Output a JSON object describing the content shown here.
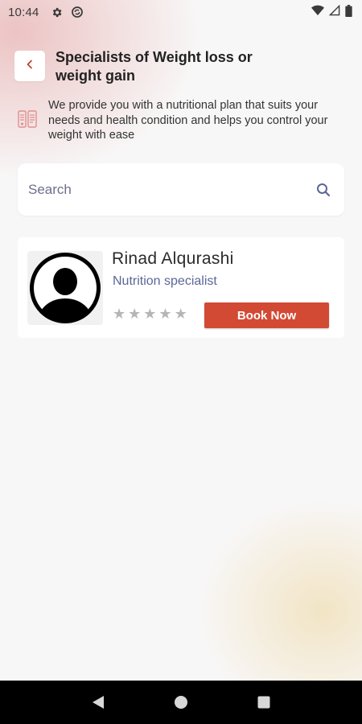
{
  "status_bar": {
    "time": "10:44",
    "icons": [
      "gear-icon",
      "sync-icon"
    ],
    "right_icons": [
      "wifi-icon",
      "signal-icon",
      "battery-icon"
    ]
  },
  "header": {
    "title": "Specialists of Weight loss or weight gain",
    "back_icon": "chevron-left-icon"
  },
  "info": {
    "icon": "nutrition-plan-icon",
    "text": "We provide you with a nutritional plan that suits your needs and health condition and helps you control your weight with ease"
  },
  "search": {
    "placeholder": "Search",
    "value": "",
    "icon": "search-icon"
  },
  "specialists": [
    {
      "name": "Rinad Alqurashi",
      "role": "Nutrition specialist",
      "rating": 0,
      "max_rating": 5,
      "book_label": "Book Now",
      "avatar": "user-avatar-placeholder"
    }
  ],
  "nav_bar": {
    "buttons": [
      "back-triangle-icon",
      "home-circle-icon",
      "recents-square-icon"
    ]
  },
  "colors": {
    "accent": "#d24a34",
    "back_chevron": "#c0392b",
    "role_text": "#5b6797",
    "star_empty": "#b5b5b5"
  }
}
